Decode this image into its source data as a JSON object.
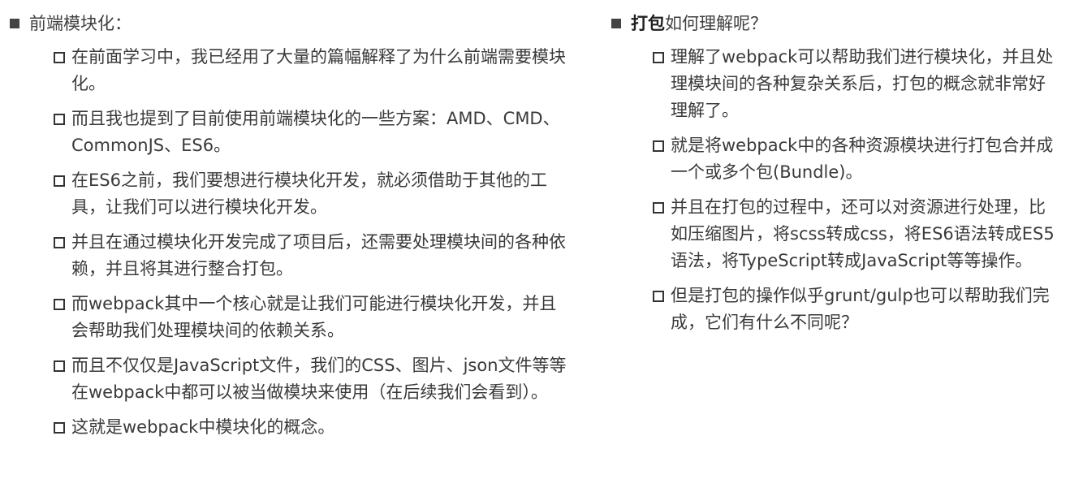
{
  "left": {
    "heading": "前端模块化：",
    "items": [
      "在前面学习中，我已经用了大量的篇幅解释了为什么前端需要模块化。",
      "而且我也提到了目前使用前端模块化的一些方案：AMD、CMD、CommonJS、ES6。",
      "在ES6之前，我们要想进行模块化开发，就必须借助于其他的工具，让我们可以进行模块化开发。",
      "并且在通过模块化开发完成了项目后，还需要处理模块间的各种依赖，并且将其进行整合打包。",
      "而webpack其中一个核心就是让我们可能进行模块化开发，并且会帮助我们处理模块间的依赖关系。",
      "而且不仅仅是JavaScript文件，我们的CSS、图片、json文件等等在webpack中都可以被当做模块来使用（在后续我们会看到）。",
      "这就是webpack中模块化的概念。"
    ]
  },
  "right": {
    "heading_bold": "打包",
    "heading_rest": "如何理解呢？",
    "items": [
      "理解了webpack可以帮助我们进行模块化，并且处理模块间的各种复杂关系后，打包的概念就非常好理解了。",
      "就是将webpack中的各种资源模块进行打包合并成一个或多个包(Bundle)。",
      "并且在打包的过程中，还可以对资源进行处理，比如压缩图片，将scss转成css，将ES6语法转成ES5语法，将TypeScript转成JavaScript等等操作。",
      "但是打包的操作似乎grunt/gulp也可以帮助我们完成，它们有什么不同呢？"
    ]
  }
}
